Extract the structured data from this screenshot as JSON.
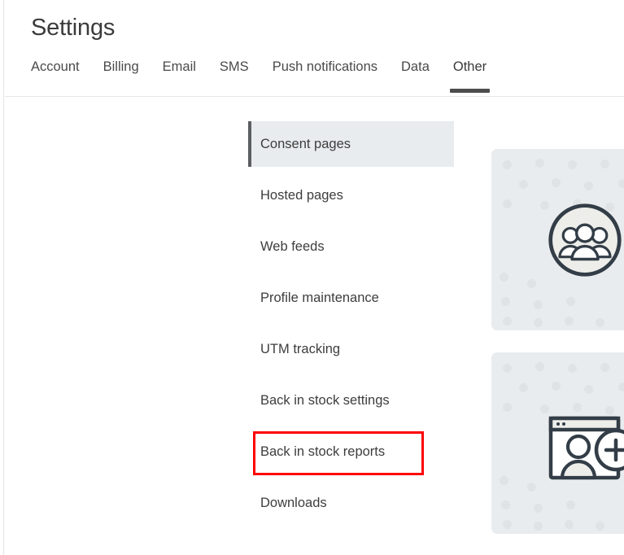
{
  "page": {
    "title": "Settings"
  },
  "tabs": [
    {
      "label": "Account",
      "active": false
    },
    {
      "label": "Billing",
      "active": false
    },
    {
      "label": "Email",
      "active": false
    },
    {
      "label": "SMS",
      "active": false
    },
    {
      "label": "Push notifications",
      "active": false
    },
    {
      "label": "Data",
      "active": false
    },
    {
      "label": "Other",
      "active": true
    }
  ],
  "subnav": {
    "items": [
      {
        "label": "Consent pages",
        "selected": true,
        "annotated": false
      },
      {
        "label": "Hosted pages",
        "selected": false,
        "annotated": false
      },
      {
        "label": "Web feeds",
        "selected": false,
        "annotated": false
      },
      {
        "label": "Profile maintenance",
        "selected": false,
        "annotated": false
      },
      {
        "label": "UTM tracking",
        "selected": false,
        "annotated": false
      },
      {
        "label": "Back in stock settings",
        "selected": false,
        "annotated": false
      },
      {
        "label": "Back in stock reports",
        "selected": false,
        "annotated": true
      },
      {
        "label": "Downloads",
        "selected": false,
        "annotated": false
      }
    ]
  },
  "cards": [
    {
      "name": "audience-card",
      "icon": "people-group-circle-icon"
    },
    {
      "name": "signup-form-card",
      "icon": "browser-add-user-icon"
    }
  ],
  "annotation": {
    "target": "Back in stock reports",
    "color": "#fe0000"
  },
  "colors": {
    "page_background": "#ffffff",
    "active_tab_underline": "#4d4d4d",
    "selected_nav_background": "#e8ecef",
    "selected_nav_marker": "#5b5f63",
    "card_background": "#e9ecee",
    "card_dot": "#dfe3e5",
    "icon_stroke": "#333d47",
    "text": "#3d3d3d",
    "highlight_box": "#fe0000"
  }
}
